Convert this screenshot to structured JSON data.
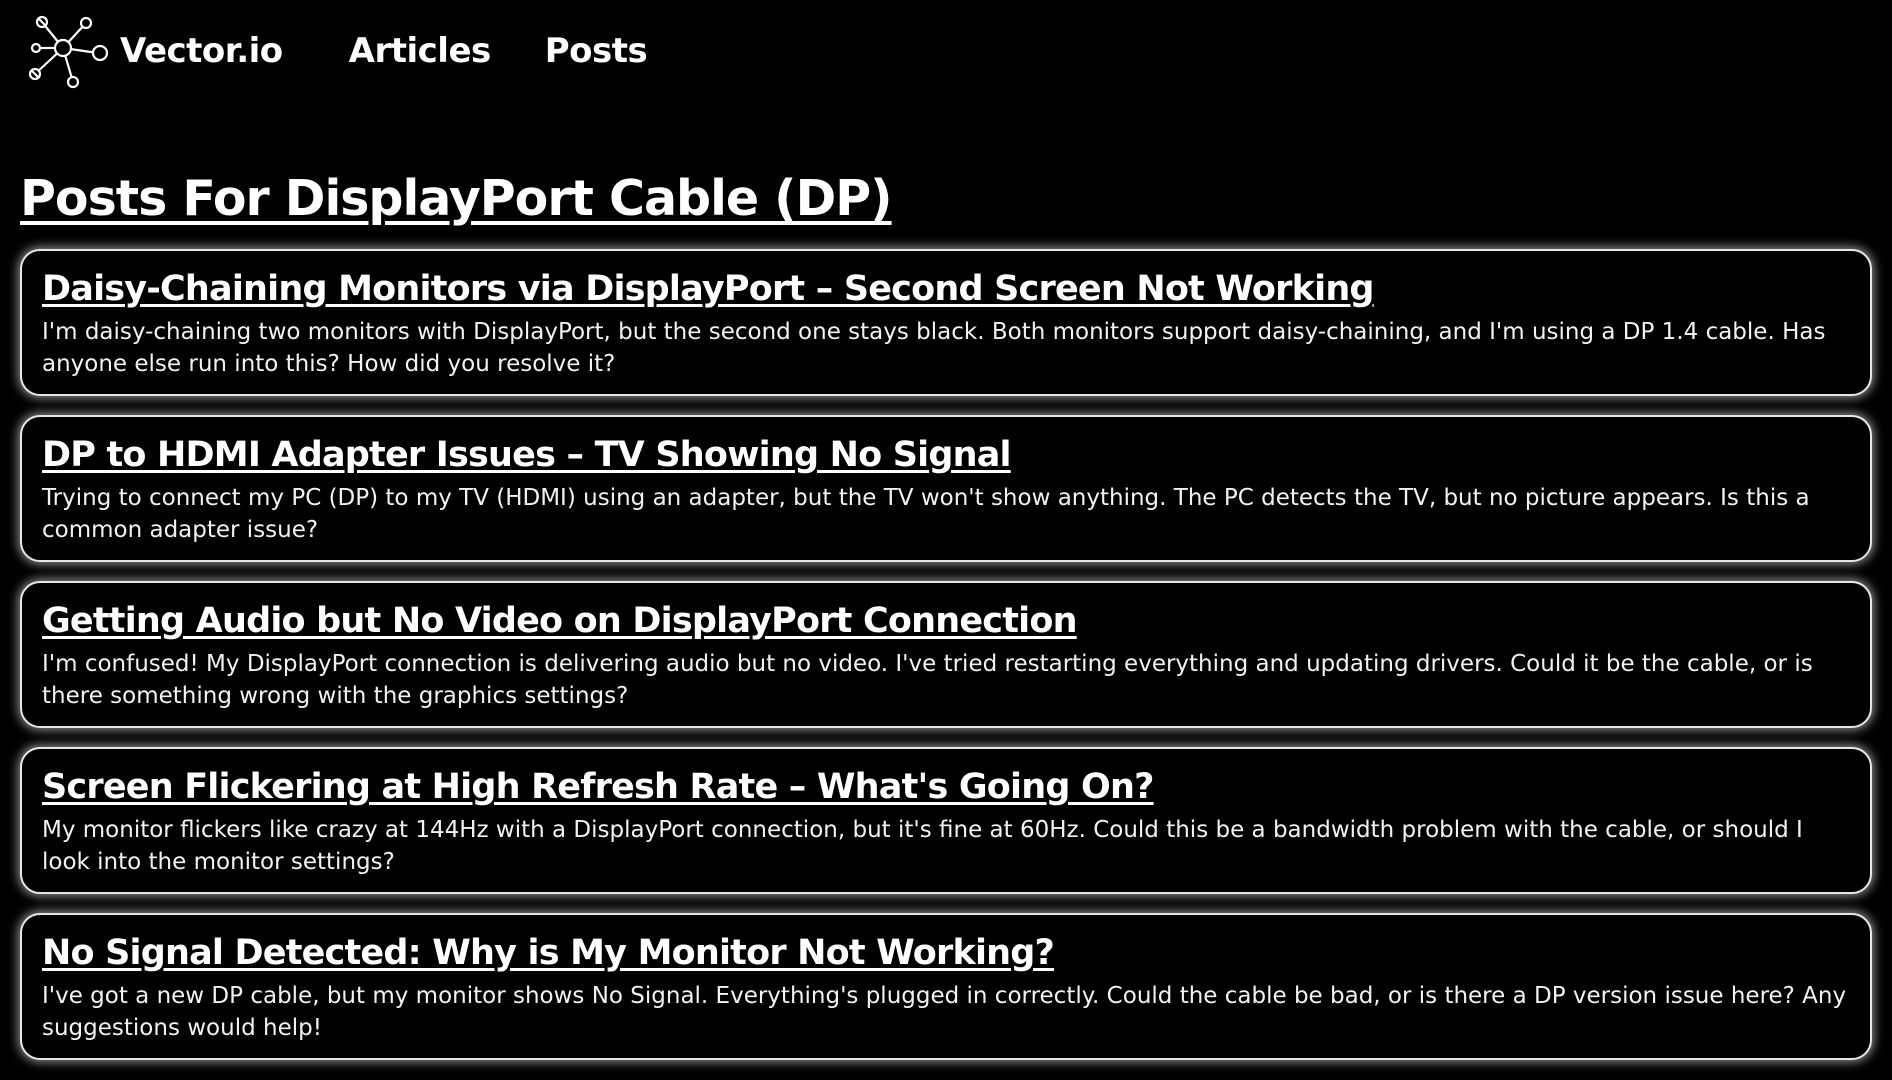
{
  "header": {
    "logo_text": "Vector.io",
    "logo_icon": "network-nodes-icon",
    "nav": [
      {
        "label": "Articles"
      },
      {
        "label": "Posts"
      }
    ]
  },
  "page": {
    "title": "Posts For DisplayPort Cable (DP)"
  },
  "posts": [
    {
      "title": "Daisy-Chaining Monitors via DisplayPort – Second Screen Not Working",
      "body": "I'm daisy-chaining two monitors with DisplayPort, but the second one stays black. Both monitors support daisy-chaining, and I'm using a DP 1.4 cable. Has anyone else run into this? How did you resolve it?"
    },
    {
      "title": "DP to HDMI Adapter Issues – TV Showing No Signal",
      "body": "Trying to connect my PC (DP) to my TV (HDMI) using an adapter, but the TV won't show anything. The PC detects the TV, but no picture appears. Is this a common adapter issue?"
    },
    {
      "title": "Getting Audio but No Video on DisplayPort Connection",
      "body": "I'm confused! My DisplayPort connection is delivering audio but no video. I've tried restarting everything and updating drivers. Could it be the cable, or is there something wrong with the graphics settings?"
    },
    {
      "title": "Screen Flickering at High Refresh Rate – What's Going On?",
      "body": "My monitor flickers like crazy at 144Hz with a DisplayPort connection, but it's fine at 60Hz. Could this be a bandwidth problem with the cable, or should I look into the monitor settings?"
    },
    {
      "title": "No Signal Detected: Why is My Monitor Not Working?",
      "body": "I've got a new DP cable, but my monitor shows No Signal. Everything's plugged in correctly. Could the cable be bad, or is there a DP version issue here? Any suggestions would help!"
    }
  ]
}
